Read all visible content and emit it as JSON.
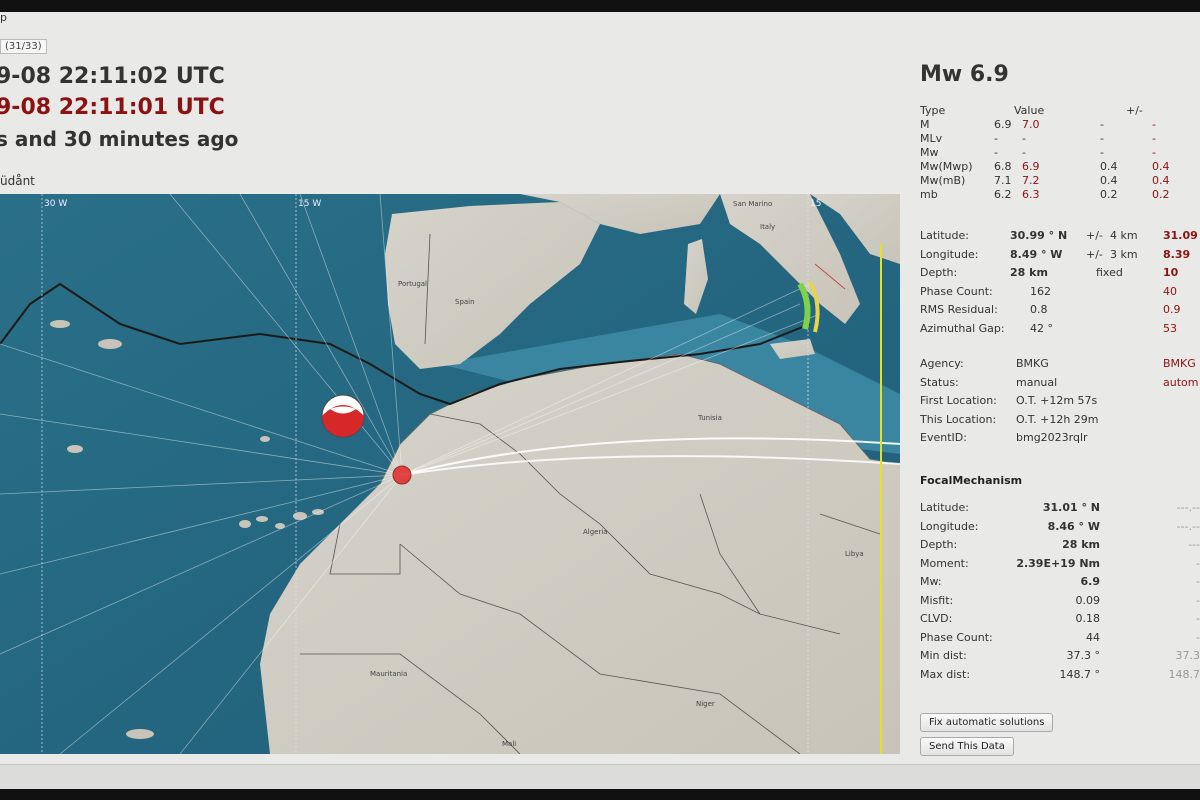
{
  "window": {
    "title_fragment": "p",
    "counter": "(31/33)"
  },
  "event": {
    "origin_time": "9-08 22:11:02 UTC",
    "local_time": "9-08 22:11:01 UTC",
    "ago": "s and 30 minutes ago",
    "region": "üdånt"
  },
  "map": {
    "lon_labels": [
      "30 W",
      "15 W",
      "15"
    ],
    "places": [
      "Portugal",
      "Spain",
      "Italy",
      "Algeria",
      "Tunisia",
      "Libya",
      "Mauritania",
      "Mali",
      "Niger",
      "San Marino"
    ]
  },
  "sidebar": {
    "magnitude": "Mw 6.9",
    "mag_table": {
      "headers": [
        "Type",
        "Value",
        "+/-"
      ],
      "rows": [
        [
          "M",
          "6.9",
          "7.0",
          "-",
          "-"
        ],
        [
          "MLv",
          "-",
          "-",
          "-",
          "-"
        ],
        [
          "Mw",
          "-",
          "-",
          "-",
          "-"
        ],
        [
          "Mw(Mwp)",
          "6.8",
          "6.9",
          "0.4",
          "0.4"
        ],
        [
          "Mw(mB)",
          "7.1",
          "7.2",
          "0.4",
          "0.4"
        ],
        [
          "mb",
          "6.2",
          "6.3",
          "0.2",
          "0.2"
        ]
      ]
    },
    "origin": [
      {
        "label": "Latitude:",
        "value": "30.99 ° N",
        "pm": "+/-",
        "unc": "4 km",
        "ref": "31.09"
      },
      {
        "label": "Longitude:",
        "value": "8.49 ° W",
        "pm": "+/-",
        "unc": "3 km",
        "ref": "8.39"
      },
      {
        "label": "Depth:",
        "value": "28 km",
        "pm": "",
        "unc": "fixed",
        "ref": "10"
      },
      {
        "label": "Phase Count:",
        "value": "162",
        "pm": "",
        "unc": "",
        "ref": "40"
      },
      {
        "label": "RMS Residual:",
        "value": "0.8",
        "pm": "",
        "unc": "",
        "ref": "0.9"
      },
      {
        "label": "Azimuthal Gap:",
        "value": "42 °",
        "pm": "",
        "unc": "",
        "ref": "53"
      }
    ],
    "meta": [
      {
        "label": "Agency:",
        "value": "BMKG",
        "ref": "BMKG"
      },
      {
        "label": "Status:",
        "value": "manual",
        "ref": "autom"
      },
      {
        "label": "First Location:",
        "value": "O.T. +12m 57s",
        "ref": ""
      },
      {
        "label": "This Location:",
        "value": "O.T. +12h 29m",
        "ref": ""
      },
      {
        "label": "EventID:",
        "value": "bmg2023rqlr",
        "ref": ""
      }
    ],
    "fm_title": "FocalMechanism",
    "fm": [
      {
        "label": "Latitude:",
        "value": "31.01 ° N",
        "ref": "---.--"
      },
      {
        "label": "Longitude:",
        "value": "8.46 ° W",
        "ref": "---.--"
      },
      {
        "label": "Depth:",
        "value": "28 km",
        "ref": "---"
      },
      {
        "label": "Moment:",
        "value": "2.39E+19 Nm",
        "ref": "-"
      },
      {
        "label": "Mw:",
        "value": "6.9",
        "ref": "-"
      },
      {
        "label": "Misfit:",
        "value": "0.09",
        "ref": "-"
      },
      {
        "label": "CLVD:",
        "value": "0.18",
        "ref": "-"
      },
      {
        "label": "Phase Count:",
        "value": "44",
        "ref": "-"
      },
      {
        "label": "Min dist:",
        "value": "37.3 °",
        "ref": "37.3"
      },
      {
        "label": "Max dist:",
        "value": "148.7 °",
        "ref": "148.7"
      }
    ],
    "buttons": {
      "fix": "Fix automatic solutions",
      "send": "Send This Data"
    }
  }
}
